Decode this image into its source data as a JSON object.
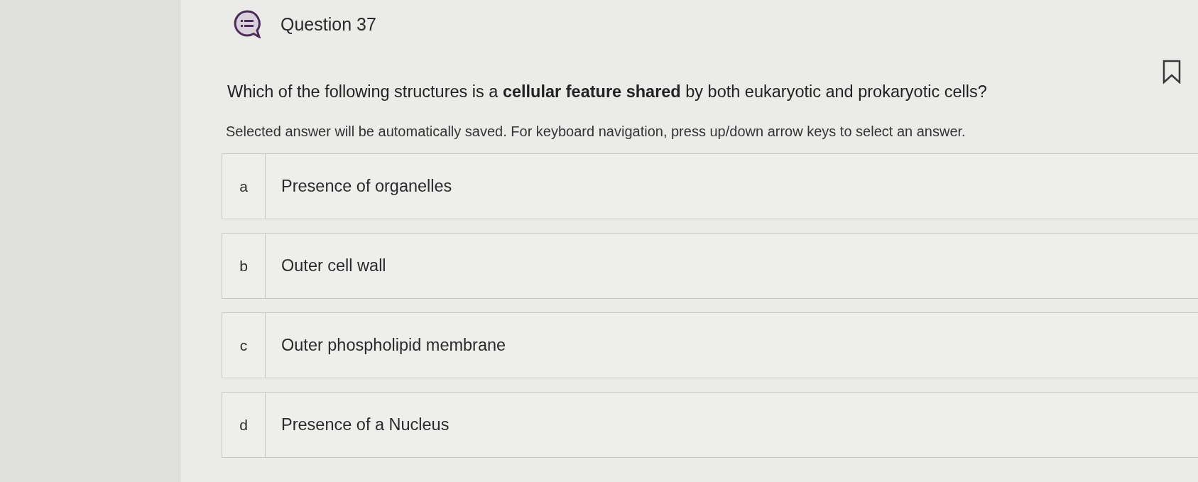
{
  "header": {
    "title": "Question 37"
  },
  "question": {
    "text": "Which of the following structures is a **cellular feature shared** by both eukaryotic and prokaryotic cells?",
    "bookmarked": false
  },
  "instructions": "Selected answer will be automatically saved. For keyboard navigation, press up/down arrow keys to select an answer.",
  "options": [
    {
      "letter": "a",
      "text": "Presence of organelles",
      "selected": false
    },
    {
      "letter": "b",
      "text": "Outer cell wall",
      "selected": false
    },
    {
      "letter": "c",
      "text": "Outer phospholipid membrane",
      "selected": false
    },
    {
      "letter": "d",
      "text": "Presence of a Nucleus",
      "selected": false
    }
  ]
}
